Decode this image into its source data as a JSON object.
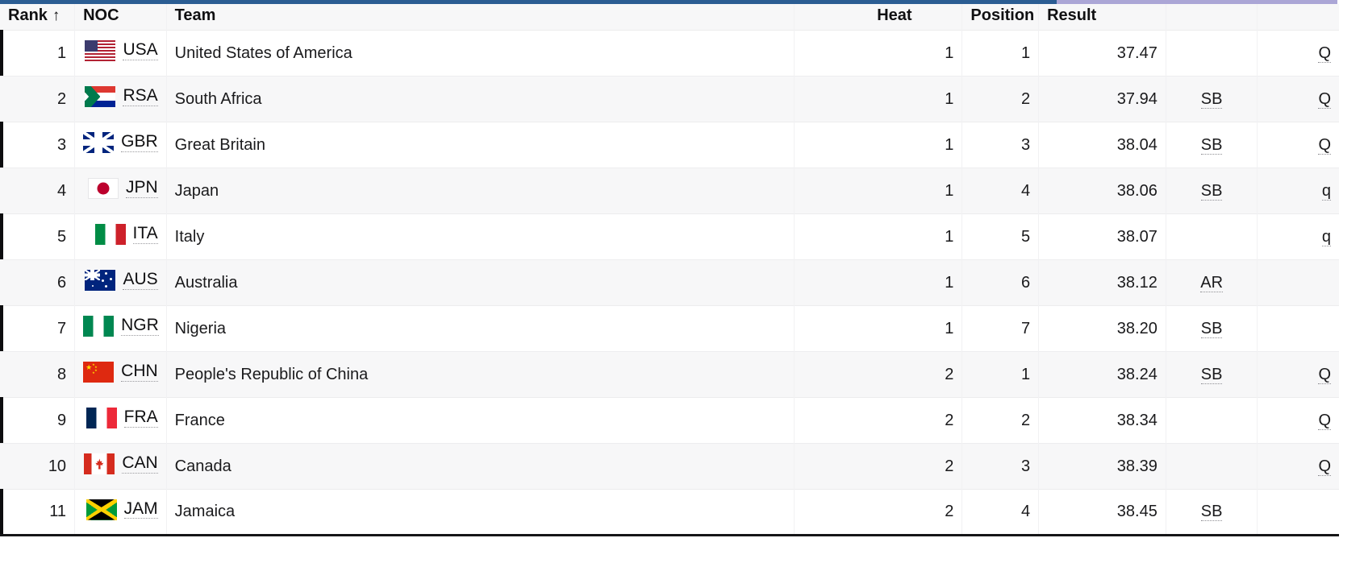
{
  "accents": {
    "primary_color": "#2b5d93",
    "secondary_color": "#aba6d6"
  },
  "table": {
    "columns": {
      "rank": "Rank",
      "sort_arrow": "↑",
      "noc": "NOC",
      "team": "Team",
      "spacer": "",
      "heat": "Heat",
      "position": "Position",
      "result": "Result",
      "record": "",
      "qualification": ""
    },
    "rows": [
      {
        "rank": "1",
        "noc": "USA",
        "flag": "usa-flag",
        "team": "United States of America",
        "heat": "1",
        "position": "1",
        "result": "37.47",
        "record": "",
        "qual": "Q"
      },
      {
        "rank": "2",
        "noc": "RSA",
        "flag": "rsa-flag",
        "team": "South Africa",
        "heat": "1",
        "position": "2",
        "result": "37.94",
        "record": "SB",
        "qual": "Q"
      },
      {
        "rank": "3",
        "noc": "GBR",
        "flag": "gbr-flag",
        "team": "Great Britain",
        "heat": "1",
        "position": "3",
        "result": "38.04",
        "record": "SB",
        "qual": "Q"
      },
      {
        "rank": "4",
        "noc": "JPN",
        "flag": "jpn-flag",
        "team": "Japan",
        "heat": "1",
        "position": "4",
        "result": "38.06",
        "record": "SB",
        "qual": "q"
      },
      {
        "rank": "5",
        "noc": "ITA",
        "flag": "ita-flag",
        "team": "Italy",
        "heat": "1",
        "position": "5",
        "result": "38.07",
        "record": "",
        "qual": "q"
      },
      {
        "rank": "6",
        "noc": "AUS",
        "flag": "aus-flag",
        "team": "Australia",
        "heat": "1",
        "position": "6",
        "result": "38.12",
        "record": "AR",
        "qual": ""
      },
      {
        "rank": "7",
        "noc": "NGR",
        "flag": "ngr-flag",
        "team": "Nigeria",
        "heat": "1",
        "position": "7",
        "result": "38.20",
        "record": "SB",
        "qual": ""
      },
      {
        "rank": "8",
        "noc": "CHN",
        "flag": "chn-flag",
        "team": "People's Republic of China",
        "heat": "2",
        "position": "1",
        "result": "38.24",
        "record": "SB",
        "qual": "Q"
      },
      {
        "rank": "9",
        "noc": "FRA",
        "flag": "fra-flag",
        "team": "France",
        "heat": "2",
        "position": "2",
        "result": "38.34",
        "record": "",
        "qual": "Q"
      },
      {
        "rank": "10",
        "noc": "CAN",
        "flag": "can-flag",
        "team": "Canada",
        "heat": "2",
        "position": "3",
        "result": "38.39",
        "record": "",
        "qual": "Q"
      },
      {
        "rank": "11",
        "noc": "JAM",
        "flag": "jam-flag",
        "team": "Jamaica",
        "heat": "2",
        "position": "4",
        "result": "38.45",
        "record": "SB",
        "qual": ""
      }
    ]
  }
}
